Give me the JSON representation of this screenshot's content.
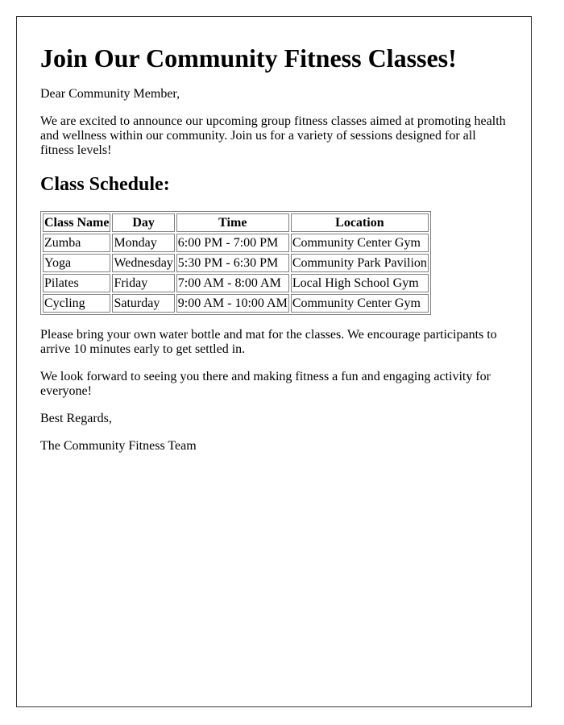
{
  "letter": {
    "title": "Join Our Community Fitness Classes!",
    "greeting": "Dear Community Member,",
    "intro": "We are excited to announce our upcoming group fitness classes aimed at promoting health and wellness within our community. Join us for a variety of sessions designed for all fitness levels!",
    "schedule_heading": "Class Schedule:",
    "schedule": {
      "headers": [
        "Class Name",
        "Day",
        "Time",
        "Location"
      ],
      "rows": [
        [
          "Zumba",
          "Monday",
          "6:00 PM - 7:00 PM",
          "Community Center Gym"
        ],
        [
          "Yoga",
          "Wednesday",
          "5:30 PM - 6:30 PM",
          "Community Park Pavilion"
        ],
        [
          "Pilates",
          "Friday",
          "7:00 AM - 8:00 AM",
          "Local High School Gym"
        ],
        [
          "Cycling",
          "Saturday",
          "9:00 AM - 10:00 AM",
          "Community Center Gym"
        ]
      ]
    },
    "notes": "Please bring your own water bottle and mat for the classes. We encourage participants to arrive 10 minutes early to get settled in.",
    "closing": "We look forward to seeing you there and making fitness a fun and engaging activity for everyone!",
    "signoff": "Best Regards,",
    "signature": "The Community Fitness Team"
  }
}
